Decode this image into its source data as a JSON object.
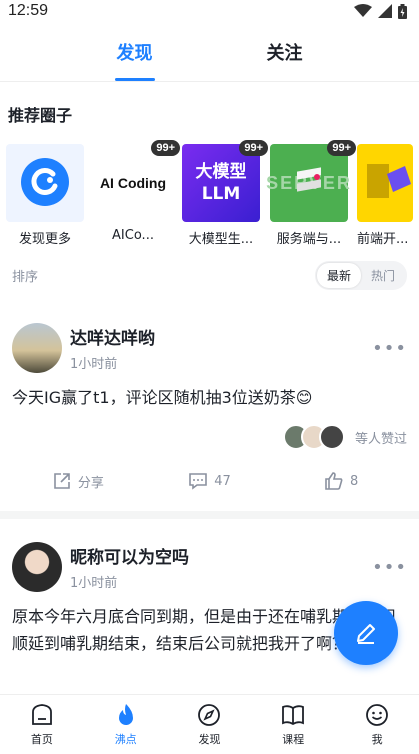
{
  "status_bar": {
    "time": "12:59"
  },
  "top_tabs": [
    {
      "label": "发现",
      "active": true
    },
    {
      "label": "关注",
      "active": false
    }
  ],
  "recommended": {
    "title": "推荐圈子",
    "items": [
      {
        "label": "发现更多",
        "badge": "",
        "image_text": ""
      },
      {
        "label": "AICo...",
        "badge": "99+",
        "image_text": "AI Coding"
      },
      {
        "label": "大模型生...",
        "badge": "99+",
        "image_text": "大模型 LLM"
      },
      {
        "label": "服务端与...",
        "badge": "99+",
        "image_text": "SERVER"
      },
      {
        "label": "前端开...",
        "badge": "",
        "image_text": ""
      }
    ]
  },
  "sort": {
    "label": "排序",
    "options": [
      {
        "label": "最新",
        "active": true
      },
      {
        "label": "热门",
        "active": false
      }
    ]
  },
  "posts": [
    {
      "author": "达咩达咩哟",
      "time": "1小时前",
      "text": "今天IG赢了t1，评论区随机抽3位送奶茶😊",
      "likers_text": "等人赞过",
      "share_label": "分享",
      "comments": "47",
      "likes": "8"
    },
    {
      "author": "昵称可以为空吗",
      "time": "1小时前",
      "text": "原本今年六月底合同到期，但是由于还在哺乳期，公司顺延到哺乳期结束，结束后公司就把我开了啊？"
    }
  ],
  "bottom_nav": [
    {
      "label": "首页",
      "icon": "home-icon",
      "active": false
    },
    {
      "label": "沸点",
      "icon": "flame-icon",
      "active": true
    },
    {
      "label": "发现",
      "icon": "compass-icon",
      "active": false
    },
    {
      "label": "课程",
      "icon": "book-icon",
      "active": false
    },
    {
      "label": "我",
      "icon": "smile-icon",
      "active": false
    }
  ],
  "colors": {
    "accent": "#1e80ff",
    "muted": "#8a919f",
    "text": "#1d2129"
  }
}
